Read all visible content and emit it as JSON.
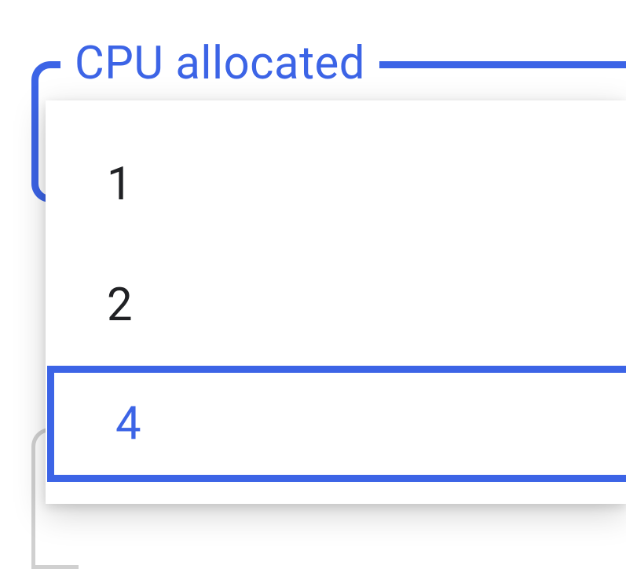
{
  "field": {
    "label": "CPU allocated"
  },
  "dropdown": {
    "options": [
      {
        "value": "1",
        "selected": false
      },
      {
        "value": "2",
        "selected": false
      },
      {
        "value": "4",
        "selected": true
      }
    ]
  },
  "colors": {
    "primary": "#3c64e6",
    "text": "#202124",
    "border_muted": "#d0d0d0"
  }
}
